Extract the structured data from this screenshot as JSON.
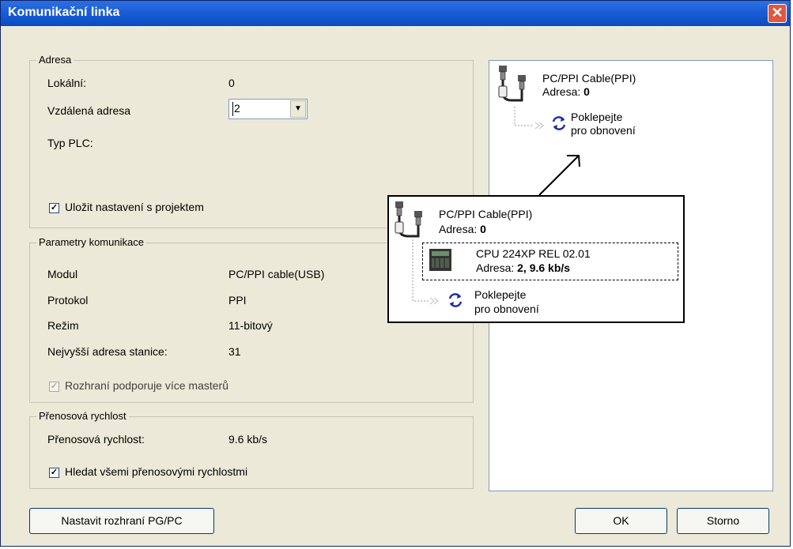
{
  "window": {
    "title": "Komunikační linka"
  },
  "address_group": {
    "legend": "Adresa",
    "local_label": "Lokální:",
    "local_value": "0",
    "remote_label": "Vzdálená adresa",
    "remote_value": "2",
    "plc_type_label": "Typ PLC:",
    "save_label": "Uložit nastavení s projektem",
    "save_checked": true
  },
  "comm_params": {
    "legend": "Parametry komunikace",
    "rows": [
      {
        "label": "Modul",
        "value": "PC/PPI cable(USB)"
      },
      {
        "label": "Protokol",
        "value": "PPI"
      },
      {
        "label": "Režim",
        "value": "11-bitový"
      },
      {
        "label": "Nejvyšší adresa stanice:",
        "value": "31"
      }
    ],
    "multimaster_label": "Rozhraní podporuje více masterů"
  },
  "baud_group": {
    "legend": "Přenosová rychlost",
    "rate_label": "Přenosová rychlost:",
    "rate_value": "9.6 kb/s",
    "search_all_label": "Hledat všemi přenosovými rychlostmi"
  },
  "tree": {
    "cable_name": "PC/PPI Cable(PPI)",
    "cable_addr_label": "Adresa: ",
    "cable_addr_value": "0",
    "refresh_line1": "Poklepejte",
    "refresh_line2": "pro obnovení"
  },
  "overlay": {
    "cable_name": "PC/PPI Cable(PPI)",
    "cable_addr_label": "Adresa: ",
    "cable_addr_value": "0",
    "cpu_name": "CPU 224XP REL 02.01",
    "cpu_addr_label": "Adresa: ",
    "cpu_addr_value": "2, 9.6 kb/s",
    "refresh_line1": "Poklepejte",
    "refresh_line2": "pro obnovení"
  },
  "buttons": {
    "set_interface": "Nastavit rozhraní PG/PC",
    "ok": "OK",
    "cancel": "Storno"
  },
  "icons": {
    "close": "close-icon",
    "dropdown": "chevron-down-icon",
    "cable": "cable-icon",
    "refresh": "refresh-icon",
    "cpu": "plc-cpu-icon"
  }
}
